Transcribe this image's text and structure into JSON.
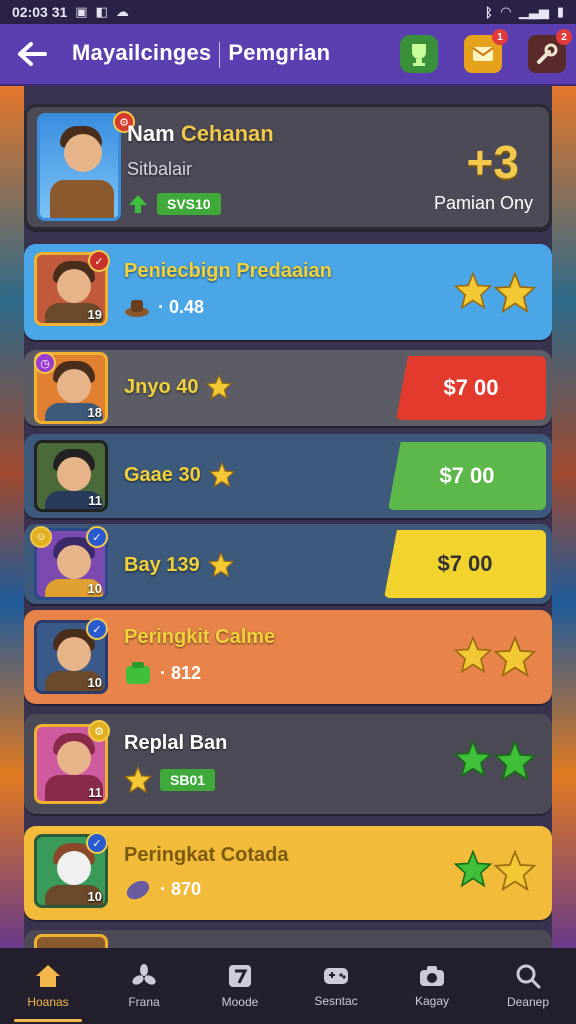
{
  "status_bar": {
    "time": "02:03 31",
    "icons": [
      "B",
      "☰",
      "▲"
    ]
  },
  "app_bar": {
    "title_left": "Mayailcinges",
    "title_right": "Pemgrian",
    "notification_count": "1",
    "alert_count": "2"
  },
  "profile": {
    "name_prefix": "Nam",
    "name_highlight": "Cehanan",
    "subtitle": "Sitbalair",
    "pill": "SVS10",
    "score": "+3",
    "score_label": "Pamian Ony"
  },
  "rows": [
    {
      "title": "Peniecbign Predaaian",
      "meta": "· 0.48",
      "level": "19",
      "stars": 2
    },
    {
      "title": "Jnyo 40",
      "price": "$7 00",
      "level": "18",
      "price_color": "#e23b2e"
    },
    {
      "title": "Gaae 30",
      "price": "$7 00",
      "level": "11",
      "price_color": "#5cb84a"
    },
    {
      "title": "Bay 139",
      "price": "$7 00",
      "level": "10",
      "price_color": "#f2d22c"
    },
    {
      "title": "Peringkit Calme",
      "meta": "· 812",
      "level": "10",
      "stars": 2
    },
    {
      "title": "Replal Ban",
      "pill": "SB01",
      "level": "11",
      "stars": 2
    },
    {
      "title": "Peringkat Cotada",
      "meta": "· 870",
      "level": "10",
      "stars": 2
    }
  ],
  "nav": [
    {
      "label": "Hoanas",
      "icon": "home-icon",
      "active": true
    },
    {
      "label": "Frana",
      "icon": "fan-icon",
      "active": false
    },
    {
      "label": "Moode",
      "icon": "mode-icon",
      "active": false
    },
    {
      "label": "Sesntac",
      "icon": "gamepad-icon",
      "active": false
    },
    {
      "label": "Kagay",
      "icon": "camera-icon",
      "active": false
    },
    {
      "label": "Deanep",
      "icon": "search-icon",
      "active": false
    }
  ]
}
